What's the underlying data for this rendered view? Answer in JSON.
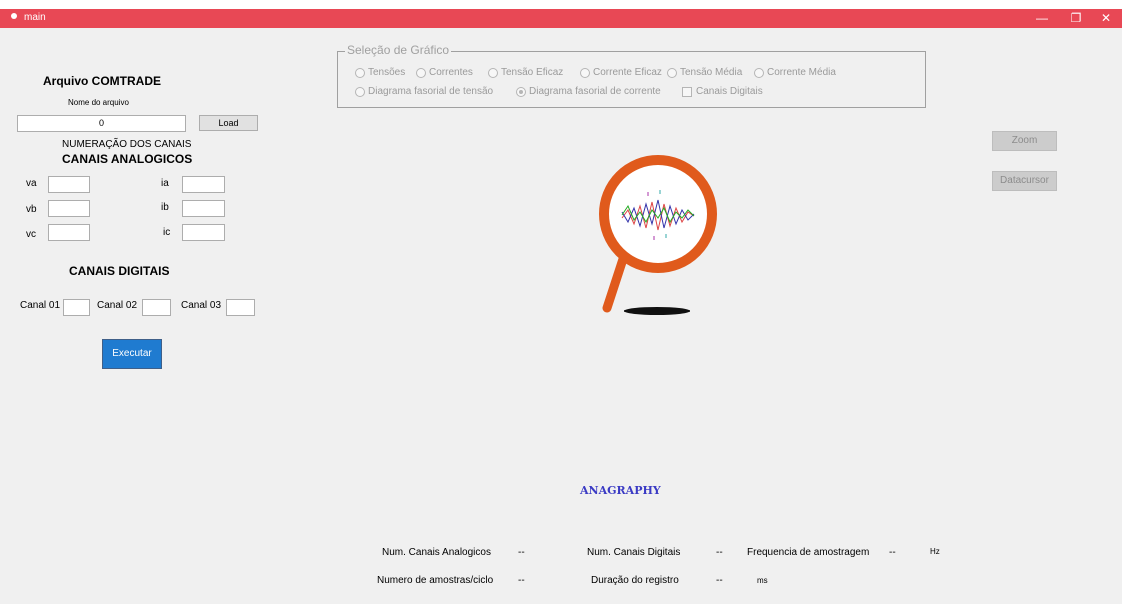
{
  "window": {
    "title": "main",
    "minimize": "—",
    "restore": "❐",
    "close": "✕"
  },
  "left": {
    "comtrade_title": "Arquivo COMTRADE",
    "file_label": "Nome do arquivo",
    "file_value": "0",
    "load_label": "Load",
    "numbering_label": "NUMERAÇÃO DOS CANAIS",
    "analog_title": "CANAIS ANALOGICOS",
    "analog": [
      {
        "label": "va"
      },
      {
        "label": "ia"
      },
      {
        "label": "vb"
      },
      {
        "label": "ib"
      },
      {
        "label": "vc"
      },
      {
        "label": "ic"
      }
    ],
    "digital_title": "CANAIS DIGITAIS",
    "digital": [
      {
        "label": "Canal 01"
      },
      {
        "label": "Canal 02"
      },
      {
        "label": "Canal 03"
      }
    ],
    "execute_label": "Executar"
  },
  "group": {
    "title": "Seleção de Gráfico",
    "row1": [
      "Tensões",
      "Correntes",
      "Tensão Eficaz",
      "Corrente Eficaz",
      "Tensão Média",
      "Corrente Média"
    ],
    "row2": [
      "Diagrama fasorial de tensão",
      "Diagrama fasorial de corrente"
    ],
    "selected": "Diagrama fasorial de corrente",
    "checkbox_label": "Canais Digitais"
  },
  "right": {
    "zoom_label": "Zoom",
    "datacursor_label": "Datacursor"
  },
  "logo": {
    "text": "ANAGRAPHY",
    "ring_color": "#e05a1c",
    "text_color": "#3a3ac4"
  },
  "stats": {
    "analog_count_label": "Num. Canais Analogicos",
    "analog_count_value": "--",
    "digital_count_label": "Num. Canais Digitais",
    "digital_count_value": "--",
    "freq_label": "Frequencia de amostragem",
    "freq_value": "--",
    "freq_unit": "Hz",
    "samples_label": "Numero de amostras/ciclo",
    "samples_value": "--",
    "duration_label": "Duração do registro",
    "duration_value": "--",
    "duration_unit": "ms"
  }
}
